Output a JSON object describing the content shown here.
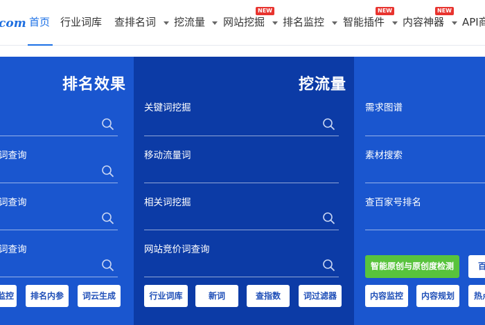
{
  "topnav": {
    "logo": "com",
    "items": [
      {
        "label": "首页"
      },
      {
        "label": "行业词库"
      },
      {
        "label": "查排名词"
      },
      {
        "label": "挖流量"
      },
      {
        "label": "网站挖掘"
      },
      {
        "label": "排名监控"
      },
      {
        "label": "智能插件"
      },
      {
        "label": "内容神器"
      },
      {
        "label": "API商"
      }
    ],
    "new_badge": "NEW"
  },
  "banner": {
    "col1": {
      "title": "排名效果",
      "fields": [
        "",
        "词查询",
        "词查询",
        "词查询"
      ],
      "buttons": [
        "监控",
        "排名内参",
        "词云生成"
      ]
    },
    "col2": {
      "title": "挖流量",
      "fields": [
        "关键词挖掘",
        "移动流量词",
        "相关词挖掘",
        "网站竞价词查询"
      ],
      "buttons": [
        "行业词库",
        "新词",
        "查指数",
        "词过滤器"
      ]
    },
    "col3": {
      "fields": [
        "需求图谱",
        "素材搜索",
        "查百家号排名"
      ],
      "green_button": "智能原创与原创度检测",
      "green_button_partial": "百",
      "buttons": [
        "内容监控",
        "内容规划",
        "热点"
      ]
    }
  },
  "colors": {
    "accent": "#1a6fe6",
    "banner_blue": "#1a56cf",
    "banner_dark": "#0c3ba6",
    "green": "#58c33c",
    "badge_red": "#e8342f"
  }
}
